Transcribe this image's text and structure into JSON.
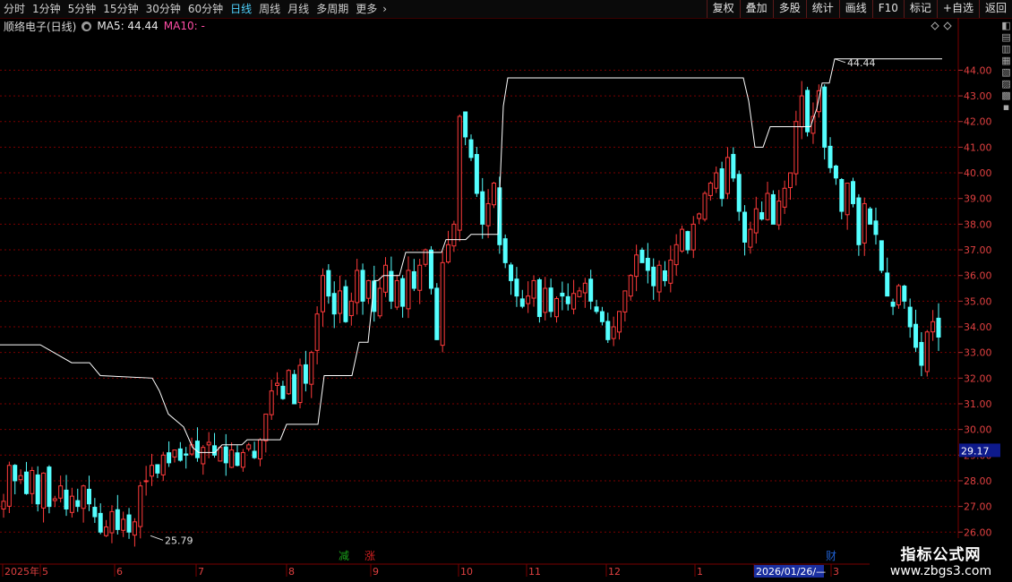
{
  "toolbar": {
    "periods": [
      "分时",
      "1分钟",
      "5分钟",
      "15分钟",
      "30分钟",
      "60分钟",
      "日线",
      "周线",
      "月线",
      "多周期",
      "更多"
    ],
    "active_index": 6,
    "tools": [
      "复权",
      "叠加",
      "多股",
      "统计",
      "画线",
      "F10",
      "标记",
      "+自选",
      "返回"
    ]
  },
  "info": {
    "stock_name": "顺络电子(日线)",
    "ma5_label": "MA5: 44.44",
    "ma10_label": "MA10: -"
  },
  "colors": {
    "up": "#ff3b3b",
    "down": "#54ffff",
    "grid": "#7a0000",
    "axis_text": "#e04040",
    "ma_line": "#ffffff",
    "current_price_bg": "#0e1a8c"
  },
  "chart_data": {
    "type": "candlestick",
    "ylim": [
      25.8,
      44.8
    ],
    "yticks": [
      "44.00",
      "43.00",
      "42.00",
      "41.00",
      "40.00",
      "39.00",
      "38.00",
      "37.00",
      "36.00",
      "35.00",
      "34.00",
      "33.00",
      "32.00",
      "31.00",
      "30.00",
      "29.00",
      "28.00",
      "27.00",
      "26.00"
    ],
    "current_price": "29.17",
    "current_price_value": 29.17,
    "high_label": "44.44",
    "high_value": 44.44,
    "low_label": "25.79",
    "low_value": 25.79,
    "x_labels": [
      "2025年",
      "5",
      "6",
      "7",
      "8",
      "9",
      "10",
      "11",
      "12",
      "1",
      "2026/01/26/—",
      "3"
    ],
    "markers": [
      {
        "label": "减",
        "color": "#1aa01a"
      },
      {
        "label": "涨",
        "color": "#d02020"
      },
      {
        "label": "财",
        "color": "#2060d0"
      }
    ],
    "close_path": [
      27.2,
      28.6,
      28.0,
      28.2,
      27.5,
      28.4,
      27.1,
      28.3,
      27.0,
      27.3,
      27.8,
      26.9,
      27.4,
      27.0,
      27.8,
      27.1,
      26.6,
      26.0,
      26.2,
      26.8,
      26.1,
      26.5,
      26.0,
      26.4,
      27.8,
      28.0,
      28.6,
      28.3,
      29.0,
      28.7,
      29.2,
      28.8,
      29.0,
      29.4,
      28.9,
      29.3,
      29.5,
      29.0,
      29.3,
      28.7,
      29.2,
      28.6,
      29.1,
      29.4,
      28.9,
      29.6,
      30.6,
      31.5,
      31.8,
      31.2,
      32.3,
      31.0,
      32.5,
      31.8,
      33.0,
      34.5,
      36.0,
      35.2,
      34.5,
      35.4,
      34.2,
      35.0,
      36.2,
      35.0,
      35.8,
      34.6,
      35.5,
      36.4,
      35.0,
      35.8,
      34.8,
      36.2,
      35.5,
      36.4,
      37.0,
      35.5,
      33.5,
      36.5,
      37.2,
      38.0,
      42.2,
      41.4,
      40.6,
      39.2,
      38.0,
      38.8,
      39.6,
      37.2,
      36.5,
      35.8,
      35.2,
      34.8,
      35.2,
      35.8,
      34.4,
      35.5,
      34.6,
      35.1,
      35.2,
      34.9,
      35.3,
      35.4,
      35.7,
      35.0,
      34.6,
      34.2,
      33.5,
      34.0,
      34.6,
      35.4,
      36.0,
      36.8,
      36.5,
      36.2,
      35.6,
      36.4,
      35.8,
      36.6,
      37.2,
      37.8,
      37.0,
      38.0,
      38.4,
      39.2,
      39.6,
      40.0,
      39.0,
      40.6,
      39.8,
      38.5,
      37.3,
      37.8,
      38.6,
      38.2,
      39.2,
      38.0,
      38.9,
      39.4,
      40.0,
      42.0,
      43.0,
      41.6,
      42.2,
      43.2,
      41.0,
      40.2,
      39.8,
      38.5,
      39.6,
      38.8,
      37.2,
      38.8,
      38.0,
      37.6,
      36.2,
      35.2,
      34.8,
      35.6,
      35.0,
      34.0,
      33.2,
      32.5,
      33.8,
      34.2,
      33.6
    ],
    "ma_path": [
      [
        0,
        33.3
      ],
      [
        45,
        33.3
      ],
      [
        80,
        32.6
      ],
      [
        100,
        32.6
      ],
      [
        112,
        32.1
      ],
      [
        170,
        32.0
      ],
      [
        178,
        31.5
      ],
      [
        188,
        30.6
      ],
      [
        205,
        30.1
      ],
      [
        215,
        29.3
      ],
      [
        222,
        29.1
      ],
      [
        240,
        29.1
      ],
      [
        248,
        29.4
      ],
      [
        270,
        29.4
      ],
      [
        276,
        29.6
      ],
      [
        313,
        29.6
      ],
      [
        320,
        30.2
      ],
      [
        355,
        30.2
      ],
      [
        362,
        32.1
      ],
      [
        393,
        32.1
      ],
      [
        401,
        33.4
      ],
      [
        411,
        33.4
      ],
      [
        418,
        35.8
      ],
      [
        422,
        35.8
      ],
      [
        428,
        36.0
      ],
      [
        446,
        36.0
      ],
      [
        453,
        36.9
      ],
      [
        493,
        36.9
      ],
      [
        498,
        37.4
      ],
      [
        520,
        37.4
      ],
      [
        526,
        37.6
      ],
      [
        556,
        37.6
      ],
      [
        562,
        42.6
      ],
      [
        567,
        43.7
      ],
      [
        830,
        43.7
      ],
      [
        836,
        42.8
      ],
      [
        843,
        41.0
      ],
      [
        852,
        41.0
      ],
      [
        860,
        41.8
      ],
      [
        905,
        41.8
      ],
      [
        912,
        42.5
      ],
      [
        918,
        43.5
      ],
      [
        926,
        43.5
      ],
      [
        932,
        44.44
      ],
      [
        1052,
        44.44
      ]
    ]
  }
}
